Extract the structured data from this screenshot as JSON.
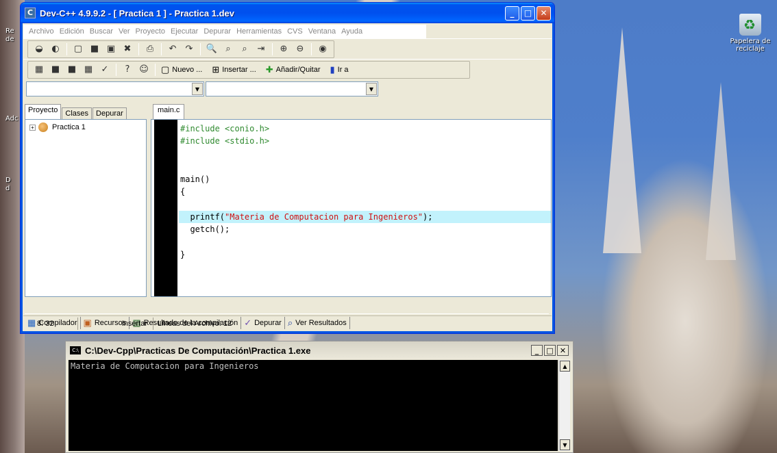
{
  "desktop": {
    "recycle_bin_label": "Papelera de reciclaje",
    "left_fragments": [
      "Re",
      "de",
      "Adc",
      "D",
      "d"
    ]
  },
  "devcpp": {
    "title": "Dev-C++ 4.9.9.2  - [ Practica 1 ] - Practica 1.dev",
    "menu": [
      "Archivo",
      "Edición",
      "Buscar",
      "Ver",
      "Proyecto",
      "Ejecutar",
      "Depurar",
      "Herramientas",
      "CVS",
      "Ventana",
      "Ayuda"
    ],
    "toolbar2": {
      "nuevo": "Nuevo ...",
      "insertar": "Insertar ...",
      "anadir": "Añadir/Quitar",
      "ir": "Ir a"
    },
    "left_tabs": [
      "Proyecto",
      "Clases",
      "Depurar"
    ],
    "tree_item": "Practica 1",
    "editor_tab": "main.c",
    "code_lines": [
      {
        "text": "#include <conio.h>",
        "kind": "pp"
      },
      {
        "text": "#include <stdio.h>",
        "kind": "pp"
      },
      {
        "text": "",
        "kind": "plain"
      },
      {
        "text": "",
        "kind": "plain"
      },
      {
        "text": "main()",
        "kind": "plain"
      },
      {
        "text": "{",
        "kind": "plain"
      },
      {
        "text": "",
        "kind": "plain"
      },
      {
        "text": "  printf(\"Materia de Computacion para Ingenieros\");",
        "kind": "hl"
      },
      {
        "text": "  getch();",
        "kind": "plain"
      },
      {
        "text": "",
        "kind": "plain"
      },
      {
        "text": "}",
        "kind": "plain"
      }
    ],
    "bottom_tabs": [
      "Compilador",
      "Recursos",
      "Resultado de la compilación",
      "Depurar",
      "Ver Resultados"
    ],
    "status": {
      "position": "8: 32",
      "mode": "Insertar",
      "lines": "Líneas del Archivo: 12"
    }
  },
  "console": {
    "title": "C:\\Dev-Cpp\\Practicas De Computación\\Practica 1.exe",
    "output": "Materia de Computacion para Ingenieros",
    "icon_text": "C:\\"
  },
  "colors": {
    "xp_blue": "#0054e3",
    "highlight_line": "#c2f2fc",
    "preprocessor": "#2f8a2f",
    "string": "#d01010"
  }
}
